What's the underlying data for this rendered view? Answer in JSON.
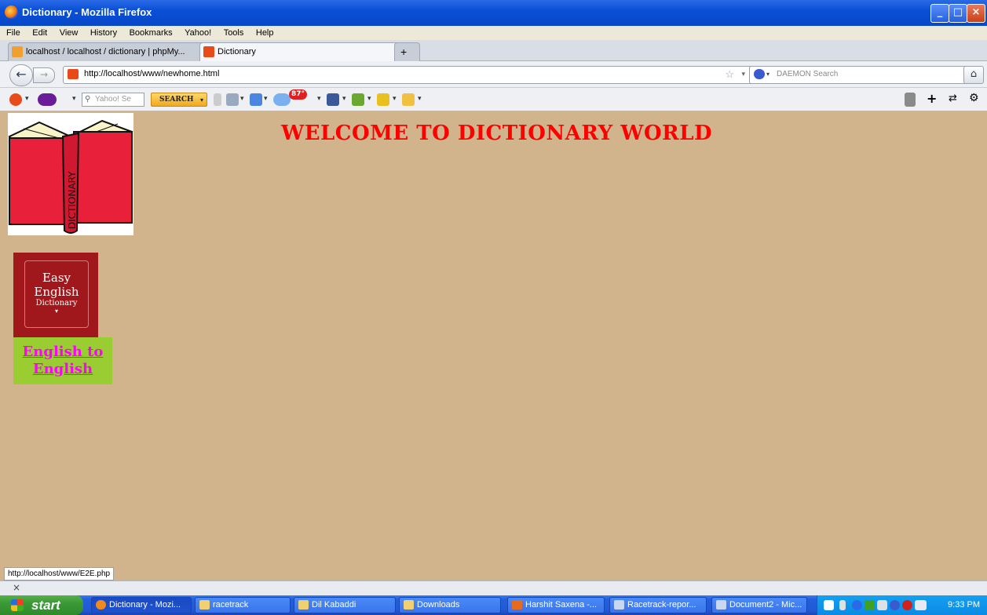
{
  "window": {
    "title": "Dictionary - Mozilla Firefox",
    "controls": [
      "_",
      "□",
      "×"
    ]
  },
  "menu": [
    "File",
    "Edit",
    "View",
    "History",
    "Bookmarks",
    "Yahoo!",
    "Tools",
    "Help"
  ],
  "tabs": [
    {
      "label": "localhost / localhost / dictionary | phpMy...",
      "close": "×"
    },
    {
      "label": "Dictionary",
      "close": "×"
    }
  ],
  "new_tab": "+",
  "nav": {
    "url": "http://localhost/www/newhome.html",
    "search_placeholder": "DAEMON Search",
    "star": "☆",
    "reload": "C"
  },
  "yahoo_toolbar": {
    "search_placeholder": "Yahoo! Se",
    "search_button": "SEARCH",
    "weather_badge": "87°"
  },
  "page": {
    "heading": "WELCOME TO DICTIONARY WORLD",
    "book_spine_text": "DICTIONARY",
    "book_cover": {
      "line1": "Easy",
      "line2": "English",
      "line3": "Dictionary"
    },
    "link_text": "English to English"
  },
  "status": {
    "url": "http://localhost/www/E2E.php",
    "addon_close": "×"
  },
  "taskbar": {
    "start": "start",
    "tasks": [
      "Dictionary - Mozi...",
      "racetrack",
      "Dil Kabaddi",
      "Downloads",
      "Harshit Saxena -...",
      "Racetrack-repor...",
      "Document2 - Mic..."
    ],
    "clock": "9:33 PM"
  },
  "colors": {
    "page_bg": "#d2b48c",
    "heading": "#ff0000",
    "link": "#ff00ff",
    "link_bg": "#9acd32"
  }
}
